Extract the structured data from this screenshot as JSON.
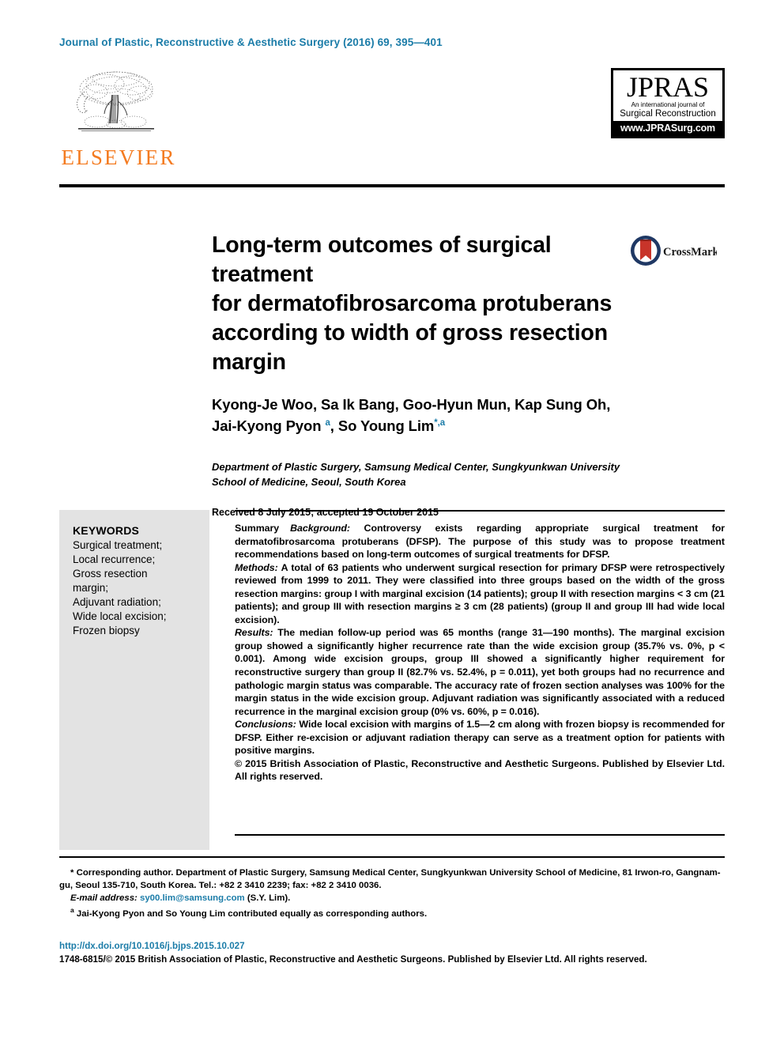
{
  "header": {
    "journal_line": "Journal of Plastic, Reconstructive & Aesthetic Surgery (2016) 69, 395—401",
    "elsevier_label": "ELSEVIER",
    "jpras": {
      "name": "JPRAS",
      "sub_line1": "An international journal of",
      "sub_line2": "Surgical Reconstruction",
      "url": "www.JPRASurg.com"
    }
  },
  "crossmark": {
    "label": "CrossMark"
  },
  "article": {
    "title_line1": "Long-term outcomes of surgical treatment",
    "title_line2": "for dermatofibrosarcoma protuberans",
    "title_line3": "according to width of gross resection margin",
    "authors_line1": "Kyong-Je Woo, Sa Ik Bang, Goo-Hyun Mun, Kap Sung Oh,",
    "authors_line2_part1": "Jai-Kyong Pyon ",
    "authors_sup_a": "a",
    "authors_line2_part2": ", So Young Lim",
    "authors_sup_star": "*,a",
    "affiliation": "Department of Plastic Surgery, Samsung Medical Center, Sungkyunkwan University School of Medicine, Seoul, South Korea",
    "received": "Received 8 July 2015; accepted 19 October 2015"
  },
  "keywords": {
    "title": "KEYWORDS",
    "items": [
      "Surgical treatment;",
      "Local recurrence;",
      "Gross resection",
      "margin;",
      "Adjuvant radiation;",
      "Wide local excision;",
      "Frozen biopsy"
    ]
  },
  "abstract": {
    "summary_label": "Summary",
    "background_label": "Background:",
    "background_text": " Controversy exists regarding appropriate surgical treatment for dermatofibrosarcoma protuberans (DFSP). The purpose of this study was to propose treatment recommendations based on long-term outcomes of surgical treatments for DFSP.",
    "methods_label": "Methods:",
    "methods_text": " A total of 63 patients who underwent surgical resection for primary DFSP were retrospectively reviewed from 1999 to 2011. They were classified into three groups based on the width of the gross resection margins: group I with marginal excision (14 patients); group II with resection margins < 3 cm (21 patients); and group III with resection margins ≥ 3 cm (28 patients) (group II and group III had wide local excision).",
    "results_label": "Results:",
    "results_text": " The median follow-up period was 65 months (range 31—190 months). The marginal excision group showed a significantly higher recurrence rate than the wide excision group (35.7% vs. 0%, p < 0.001). Among wide excision groups, group III showed a significantly higher requirement for reconstructive surgery than group II (82.7% vs. 52.4%, p = 0.011), yet both groups had no recurrence and pathologic margin status was comparable. The accuracy rate of frozen section analyses was 100% for the margin status in the wide excision group. Adjuvant radiation was significantly associated with a reduced recurrence in the marginal excision group (0% vs. 60%, p = 0.016).",
    "conclusions_label": "Conclusions:",
    "conclusions_text": " Wide local excision with margins of 1.5—2 cm along with frozen biopsy is recommended for DFSP. Either re-excision or adjuvant radiation therapy can serve as a treatment option for patients with positive margins.",
    "copyright": "© 2015 British Association of Plastic, Reconstructive and Aesthetic Surgeons. Published by Elsevier Ltd. All rights reserved."
  },
  "footnotes": {
    "corresponding_marker": "*",
    "corresponding_text": " Corresponding author. Department of Plastic Surgery, Samsung Medical Center, Sungkyunkwan University School of Medicine, 81 Irwon-ro, Gangnam-gu, Seoul 135-710, South Korea. Tel.: +82 2 3410 2239; fax: +82 2 3410 0036.",
    "email_label": "E-mail address:",
    "email_value": "sy00.lim@samsung.com",
    "email_suffix": " (S.Y. Lim).",
    "equal_contribution_marker": "a",
    "equal_contribution_text": " Jai-Kyong Pyon and So Young Lim contributed equally as corresponding authors."
  },
  "bottom": {
    "doi": "http://dx.doi.org/10.1016/j.bjps.2015.10.027",
    "issn_line": "1748-6815/© 2015 British Association of Plastic, Reconstructive and Aesthetic Surgeons. Published by Elsevier Ltd. All rights reserved."
  },
  "colors": {
    "accent_blue": "#1b7ca8",
    "elsevier_orange": "#F47B20",
    "keywords_bg": "#e3e3e3"
  }
}
